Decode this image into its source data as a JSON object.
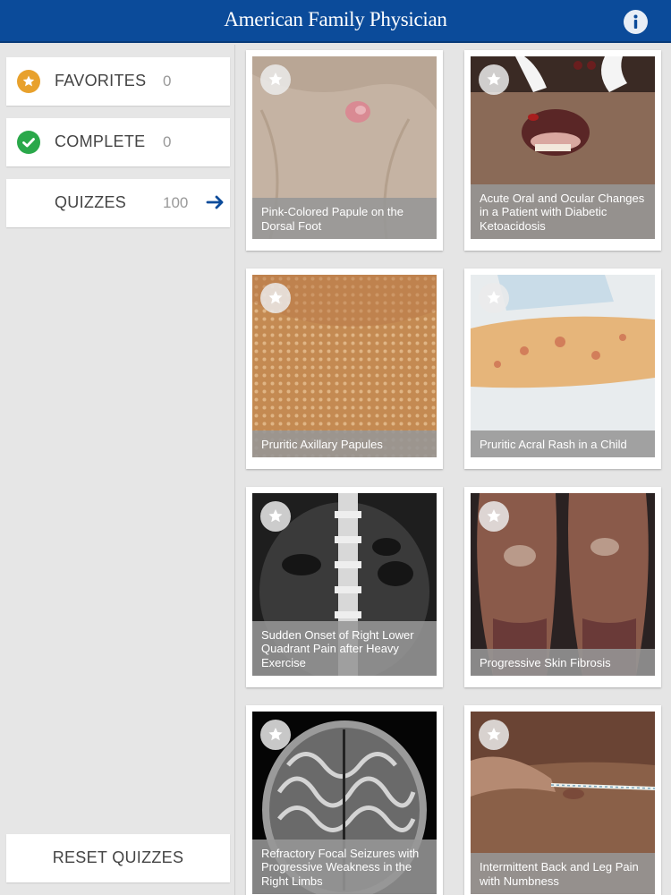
{
  "header": {
    "title": "American Family Physician"
  },
  "sidebar": {
    "items": [
      {
        "label": "FAVORITES",
        "count": "0",
        "icon": "star-icon",
        "color": "#e8a12c"
      },
      {
        "label": "COMPLETE",
        "count": "0",
        "icon": "check-icon",
        "color": "#2aa84a"
      },
      {
        "label": "QUIZZES",
        "count": "100",
        "icon": "arrow-right-icon",
        "color": "#0b4b9a"
      }
    ],
    "reset_label": "RESET QUIZZES"
  },
  "quizzes": [
    {
      "caption": "Pink-Colored Papule on the Dorsal Foot"
    },
    {
      "caption": "Acute Oral and Ocular Changes in a Patient with Diabetic Ketoacidosis"
    },
    {
      "caption": "Pruritic Axillary Papules"
    },
    {
      "caption": "Pruritic Acral Rash in a Child"
    },
    {
      "caption": "Sudden Onset of Right Lower Quadrant Pain after Heavy Exercise"
    },
    {
      "caption": "Progressive Skin Fibrosis"
    },
    {
      "caption": "Refractory Focal Seizures with Progressive Weakness in the Right Limbs"
    },
    {
      "caption": "Intermittent Back and Leg Pain with Numbness"
    }
  ],
  "colors": {
    "header_bg": "#0b4b9a",
    "caption_bg": "#969696"
  }
}
